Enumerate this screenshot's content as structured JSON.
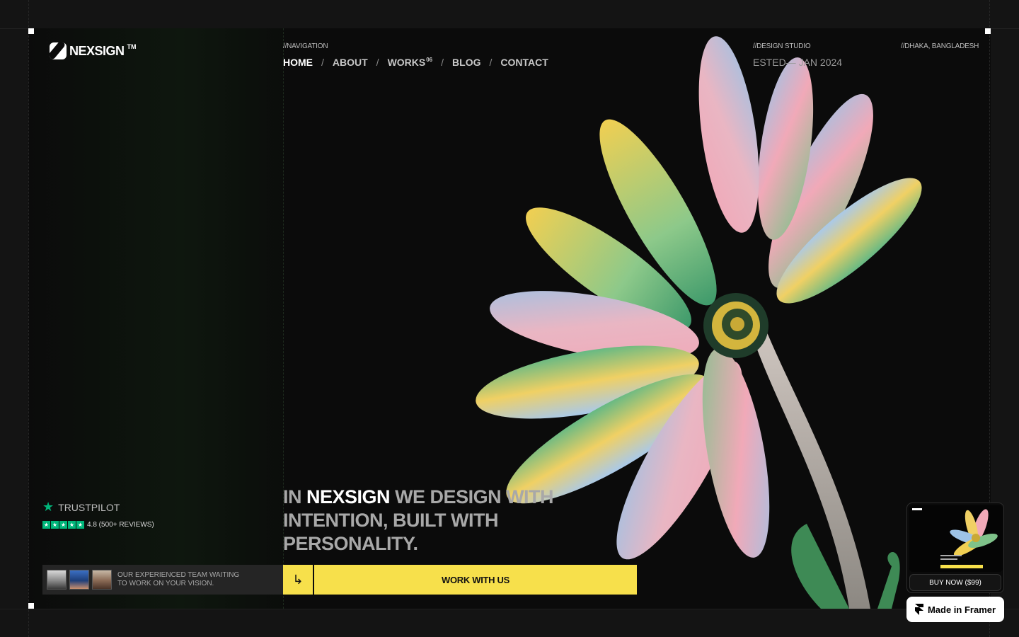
{
  "brand": {
    "name": "NEXSIGN",
    "tm": "TM"
  },
  "labels": {
    "navigation": "//NAVIGATION",
    "studio": "//DESIGN STUDIO",
    "location": "//DHAKA, BANGLADESH"
  },
  "nav": {
    "home": "HOME",
    "about": "ABOUT",
    "works": "WORKS",
    "works_count": "06",
    "blog": "BLOG",
    "contact": "CONTACT",
    "separator": "/"
  },
  "established": "ESTED— JAN 2024",
  "hero": {
    "prefix": "IN",
    "brand": "NEXSIGN",
    "rest": "WE DESIGN WITH INTENTION, BUILT WITH PERSONALITY."
  },
  "trustpilot": {
    "label": "TRUSTPILOT",
    "rating": "4.8 (500+ REVIEWS)"
  },
  "team": {
    "line1": "OUR EXPERIENCED TEAM WAITING",
    "line2": "TO WORK ON YOUR VISION."
  },
  "cta": {
    "arrow": "↳",
    "label": "WORK WITH US"
  },
  "template": {
    "buy_label": "BUY NOW ($99)"
  },
  "framer": {
    "label": "Made in Framer"
  },
  "colors": {
    "accent": "#f7e04b",
    "trustpilot": "#00b67a",
    "background": "#0b0b0b"
  }
}
